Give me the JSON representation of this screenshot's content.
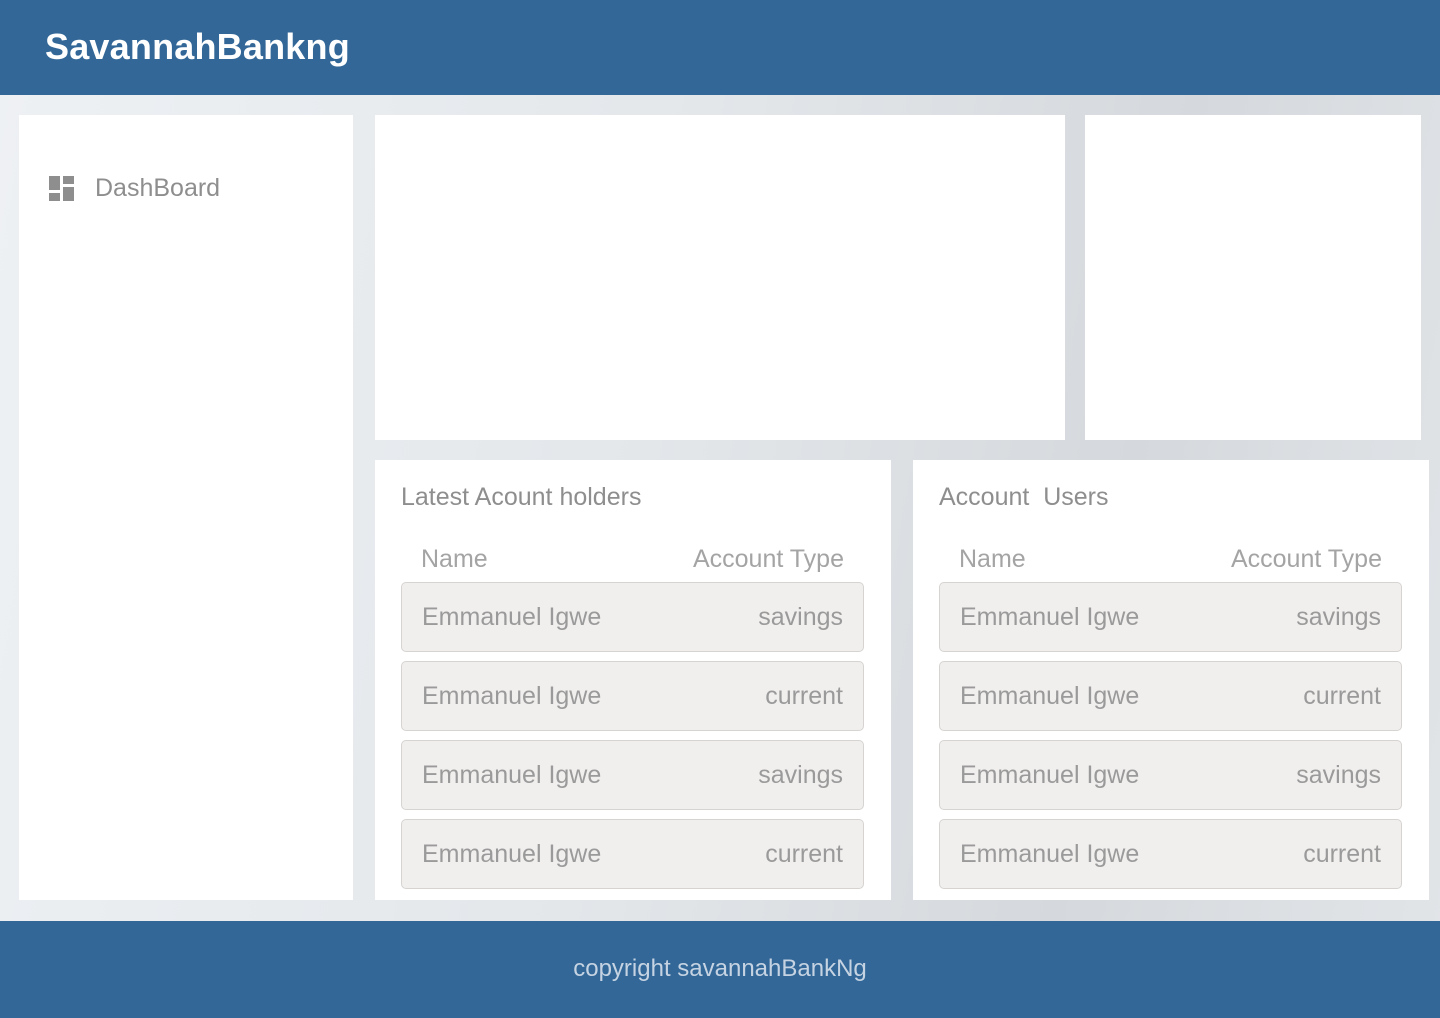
{
  "header": {
    "brand": "SavannahBankng"
  },
  "sidebar": {
    "items": [
      {
        "label": "DashBoard",
        "icon": "dashboard-icon"
      }
    ]
  },
  "latest_holders": {
    "title": "Latest Acount holders",
    "columns": {
      "name": "Name",
      "type": "Account Type"
    },
    "rows": [
      {
        "name": "Emmanuel Igwe",
        "type": "savings"
      },
      {
        "name": "Emmanuel Igwe",
        "type": "current"
      },
      {
        "name": "Emmanuel Igwe",
        "type": "savings"
      },
      {
        "name": "Emmanuel Igwe",
        "type": "current"
      }
    ]
  },
  "account_users": {
    "title": "Account  Users",
    "columns": {
      "name": "Name",
      "type": "Account Type"
    },
    "rows": [
      {
        "name": "Emmanuel Igwe",
        "type": "savings"
      },
      {
        "name": "Emmanuel Igwe",
        "type": "current"
      },
      {
        "name": "Emmanuel Igwe",
        "type": "savings"
      },
      {
        "name": "Emmanuel Igwe",
        "type": "current"
      }
    ]
  },
  "footer": {
    "copyright": "copyright savannahBankNg"
  },
  "colors": {
    "primary": "#326797",
    "row_background": "#f1efee",
    "text_muted": "#8e8e8e"
  }
}
